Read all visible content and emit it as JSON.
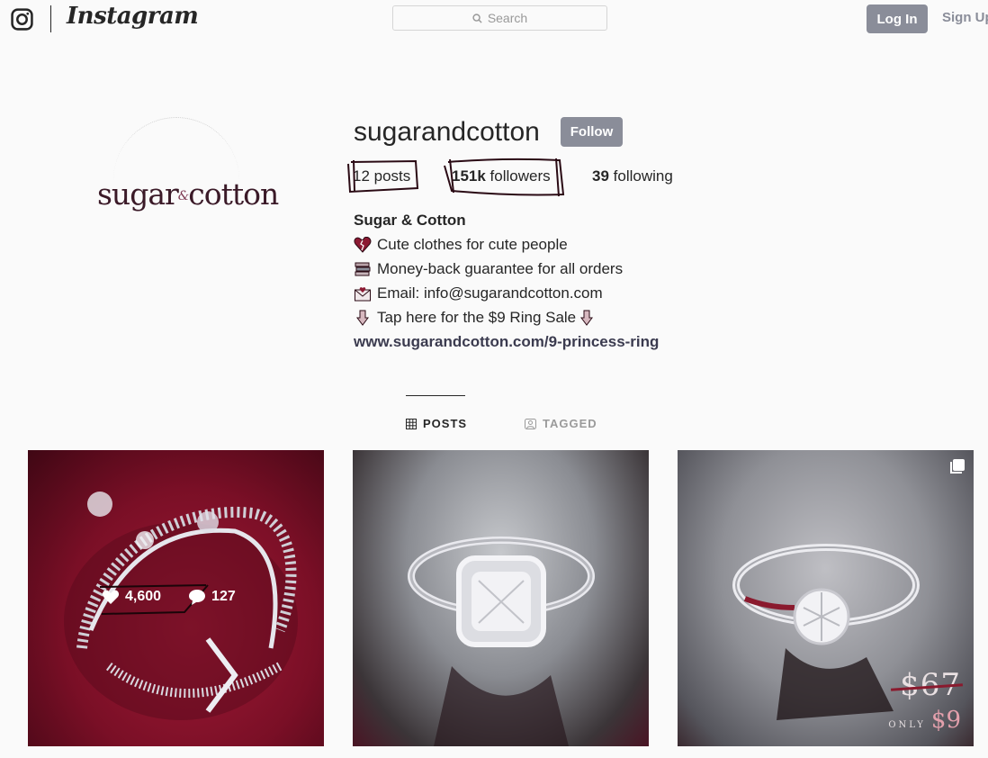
{
  "header": {
    "wordmark": "Instagram",
    "search_placeholder": "Search",
    "login_label": "Log In",
    "signup_label": "Sign Up"
  },
  "profile": {
    "avatar_text_left": "sugar",
    "avatar_text_amp": "&",
    "avatar_text_right": "cotton",
    "username": "sugarandcotton",
    "follow_label": "Follow",
    "stats": {
      "posts_count": "12",
      "posts_label": " posts",
      "followers_count": "151k",
      "followers_label": " followers",
      "following_count": "39",
      "following_label": " following"
    },
    "bio": {
      "name": "Sugar & Cotton",
      "lines": [
        {
          "icon": "broken-heart-icon",
          "text": "Cute clothes for cute people"
        },
        {
          "icon": "books-icon",
          "text": "Money-back guarantee for all orders"
        },
        {
          "icon": "envelope-heart-icon",
          "text": "Email: info@sugarandcotton.com"
        },
        {
          "icon": "pointing-down-icon",
          "text": "Tap here for the $9 Ring Sale"
        }
      ],
      "link": "www.sugarandcotton.com/9-princess-ring"
    }
  },
  "tabs": [
    {
      "label": "POSTS",
      "active": true
    },
    {
      "label": "TAGGED",
      "active": false
    }
  ],
  "posts": [
    {
      "subject": "crown ring",
      "likes": "4,600",
      "comments": "127"
    },
    {
      "subject": "cushion halo ring"
    },
    {
      "subject": "solitaire ring",
      "price_old": "$67",
      "price_only": "ONLY",
      "price_new": "$9"
    }
  ],
  "colors": {
    "button": "#8a8d99",
    "annotation": "#3b0f1c",
    "text": "#262626"
  }
}
